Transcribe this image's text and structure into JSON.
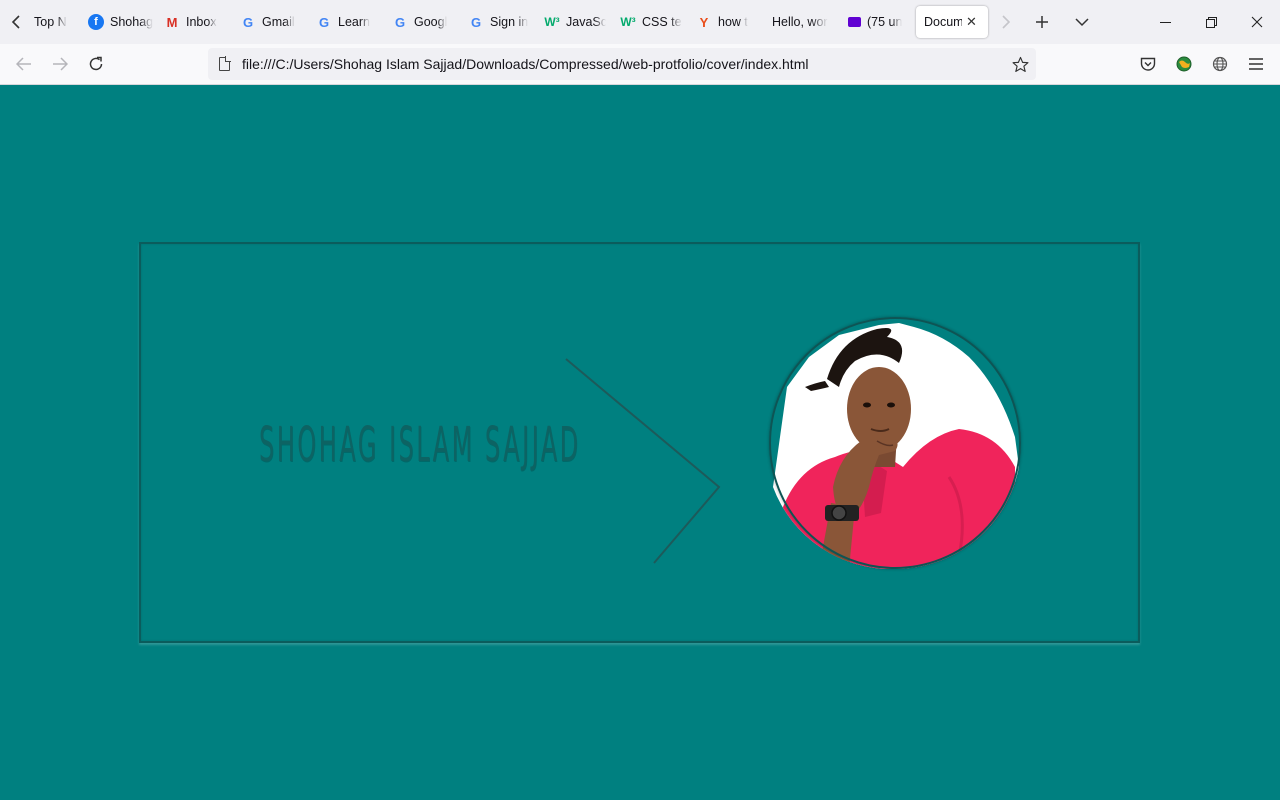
{
  "browser": {
    "tabs": [
      {
        "title": "Top N",
        "icon": "firefox-page-icon"
      },
      {
        "title": "Shohag",
        "icon": "facebook-icon"
      },
      {
        "title": "Inbox",
        "icon": "gmail-icon"
      },
      {
        "title": "Gmail",
        "icon": "google-icon"
      },
      {
        "title": "Learn",
        "icon": "google-icon"
      },
      {
        "title": "Googl",
        "icon": "google-icon"
      },
      {
        "title": "Sign in",
        "icon": "google-icon"
      },
      {
        "title": "JavaSc",
        "icon": "w3schools-icon"
      },
      {
        "title": "CSS te",
        "icon": "w3schools-icon"
      },
      {
        "title": "how t",
        "icon": "yandex-icon"
      },
      {
        "title": "Hello, wor",
        "icon": ""
      },
      {
        "title": "(75 un",
        "icon": "yahoo-mail-icon"
      },
      {
        "title": "Docum",
        "icon": "",
        "active": true
      }
    ],
    "url": "file:///C:/Users/Shohag Islam Sajjad/Downloads/Compressed/web-protfolio/cover/index.html"
  },
  "page": {
    "background_color": "#008080",
    "name": "SHOHAG ISLAM SAJJAD",
    "text_color": "#0d6363",
    "shirt_color": "#f0245b"
  }
}
